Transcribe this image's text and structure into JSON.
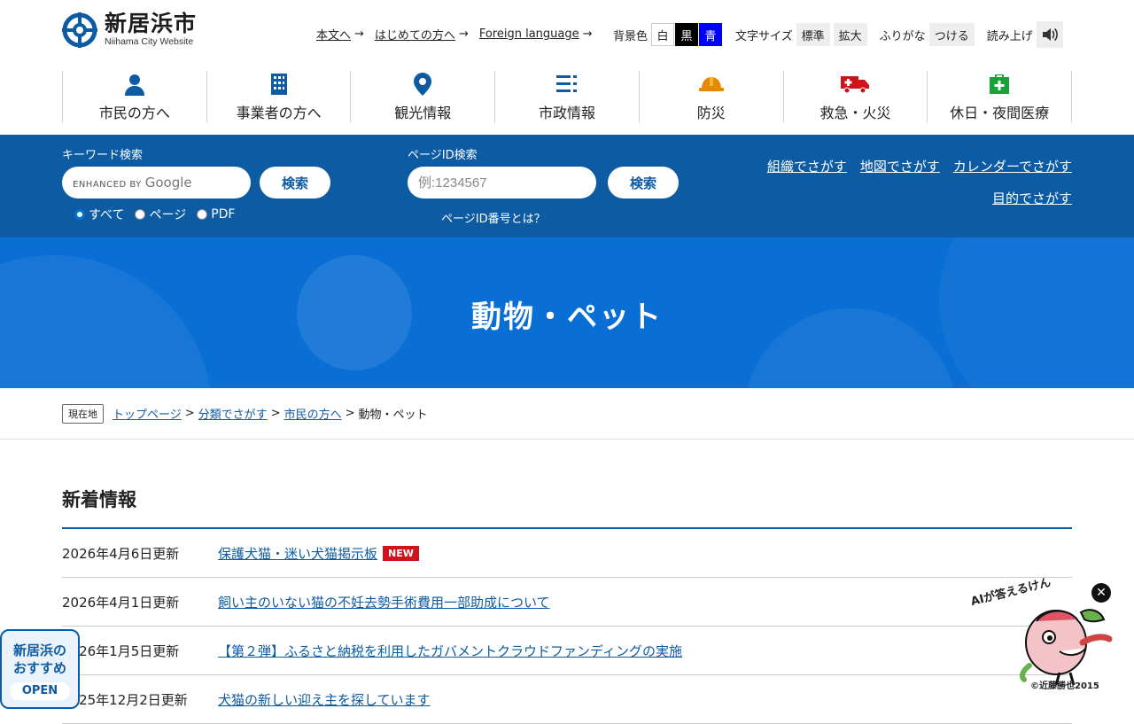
{
  "site": {
    "name_ja": "新居浜市",
    "name_en": "Niihama City Website"
  },
  "toplinks": [
    {
      "label": "本文へ"
    },
    {
      "label": "はじめての方へ"
    },
    {
      "label": "Foreign language"
    }
  ],
  "tools": {
    "bg_label": "背景色",
    "bg_options": [
      "白",
      "黒",
      "青"
    ],
    "font_label": "文字サイズ",
    "font_options": [
      "標準",
      "拡大"
    ],
    "furigana_label": "ふりがな",
    "furigana_button": "つける",
    "read_label": "読み上げ",
    "read_icon": "speaker-icon"
  },
  "gnav": [
    {
      "label": "市民の方へ",
      "icon": "person-icon",
      "color": "#0d5ba3"
    },
    {
      "label": "事業者の方へ",
      "icon": "building-icon",
      "color": "#0d5ba3"
    },
    {
      "label": "観光情報",
      "icon": "map-pin-icon",
      "color": "#0d5ba3"
    },
    {
      "label": "市政情報",
      "icon": "list-icon",
      "color": "#0d5ba3"
    },
    {
      "label": "防災",
      "icon": "helmet-icon",
      "color": "#e58a00"
    },
    {
      "label": "救急・火災",
      "icon": "ambulance-icon",
      "color": "#d0121b"
    },
    {
      "label": "休日・夜間医療",
      "icon": "medical-kit-icon",
      "color": "#1aa23a"
    }
  ],
  "search": {
    "keyword_label": "キーワード検索",
    "keyword_brand_small": "ENHANCED BY",
    "keyword_brand": "Google",
    "search_button": "検索",
    "radios": [
      {
        "label": "すべて",
        "checked": true
      },
      {
        "label": "ページ",
        "checked": false
      },
      {
        "label": "PDF",
        "checked": false
      }
    ],
    "pageid_label": "ページID検索",
    "pageid_placeholder": "例:1234567",
    "pageid_button": "検索",
    "pageid_help": "ページID番号とは？",
    "links": [
      "組織でさがす",
      "地図でさがす",
      "カレンダーでさがす",
      "目的でさがす"
    ]
  },
  "hero": {
    "title": "動物・ペット"
  },
  "breadcrumb": {
    "here_label": "現在地",
    "items": [
      "トップページ",
      "分類でさがす",
      "市民の方へ"
    ],
    "current": "動物・ペット"
  },
  "news": {
    "heading": "新着情報",
    "new_badge": "NEW",
    "items": [
      {
        "date": "2026年4月6日更新",
        "title": "保護犬猫・迷い犬猫掲示板",
        "is_new": true
      },
      {
        "date": "2026年4月1日更新",
        "title": "飼い主のいない猫の不妊去勢手術費用一部助成について",
        "is_new": false
      },
      {
        "date": "2026年1月5日更新",
        "title": "【第２弾】ふるさと納税を利用したガバメントクラウドファンディングの実施",
        "is_new": false
      },
      {
        "date": "2025年12月2日更新",
        "title": "犬猫の新しい迎え主を探しています",
        "is_new": false
      }
    ]
  },
  "widgets": {
    "recommend_line1": "新居浜の",
    "recommend_line2": "おすすめ",
    "recommend_open": "OPEN",
    "ai_caption": "AIが答えるけん",
    "ai_copyright": "©近藤勝也2015",
    "ai_close_icon": "close-icon"
  },
  "colors": {
    "primary": "#0d5ba3",
    "hero": "#0a6fd4",
    "new_badge": "#d0121b"
  }
}
